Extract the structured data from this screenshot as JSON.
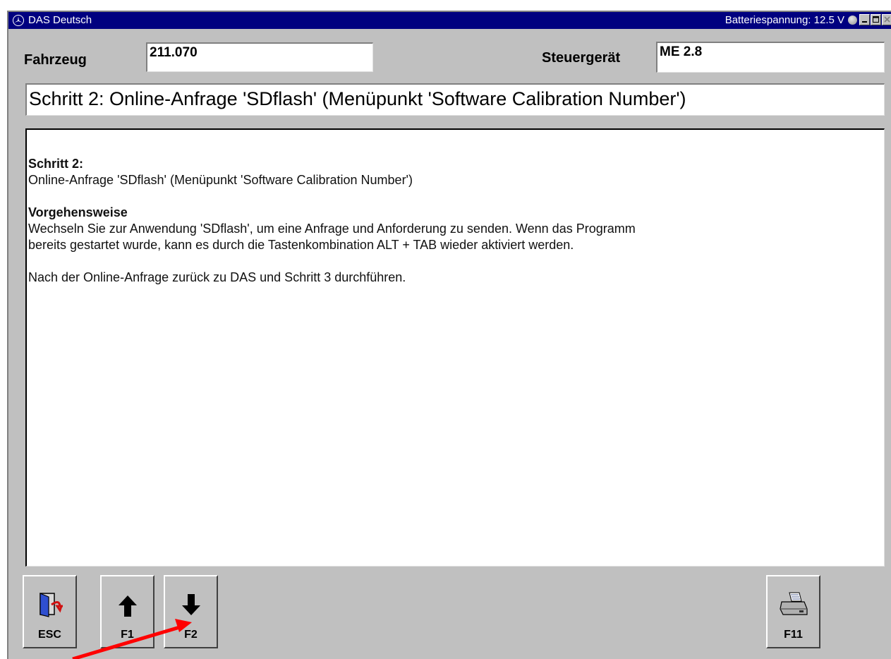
{
  "window": {
    "title": "DAS Deutsch",
    "battery_status": "Batteriespannung: 12.5 V",
    "title_bar_color": "#000080"
  },
  "header": {
    "vehicle_label": "Fahrzeug",
    "vehicle_value": "211.070",
    "ecu_label": "Steuergerät",
    "ecu_value": "ME 2.8"
  },
  "step_title": "Schritt 2: Online-Anfrage 'SDflash' (Menüpunkt 'Software Calibration Number')",
  "content": {
    "heading1": "Schritt 2:",
    "line1": "Online-Anfrage 'SDflash' (Menüpunkt 'Software Calibration Number')",
    "heading2": "Vorgehensweise",
    "line2": "Wechseln Sie zur Anwendung 'SDflash', um eine Anfrage und Anforderung zu senden. Wenn das Programm",
    "line3": "bereits gestartet wurde, kann es durch die Tastenkombination ALT + TAB wieder aktiviert werden.",
    "line4": "Nach der Online-Anfrage zurück zu DAS und Schritt 3 durchführen."
  },
  "buttons": [
    {
      "key": "ESC",
      "icon": "exit-door-icon"
    },
    {
      "key": "F1",
      "icon": "arrow-up-icon"
    },
    {
      "key": "F2",
      "icon": "arrow-down-icon"
    },
    {
      "key": "F11",
      "icon": "printer-icon"
    }
  ],
  "annotation": {
    "icon": "red-arrow-pointer",
    "color": "#ff0000"
  }
}
